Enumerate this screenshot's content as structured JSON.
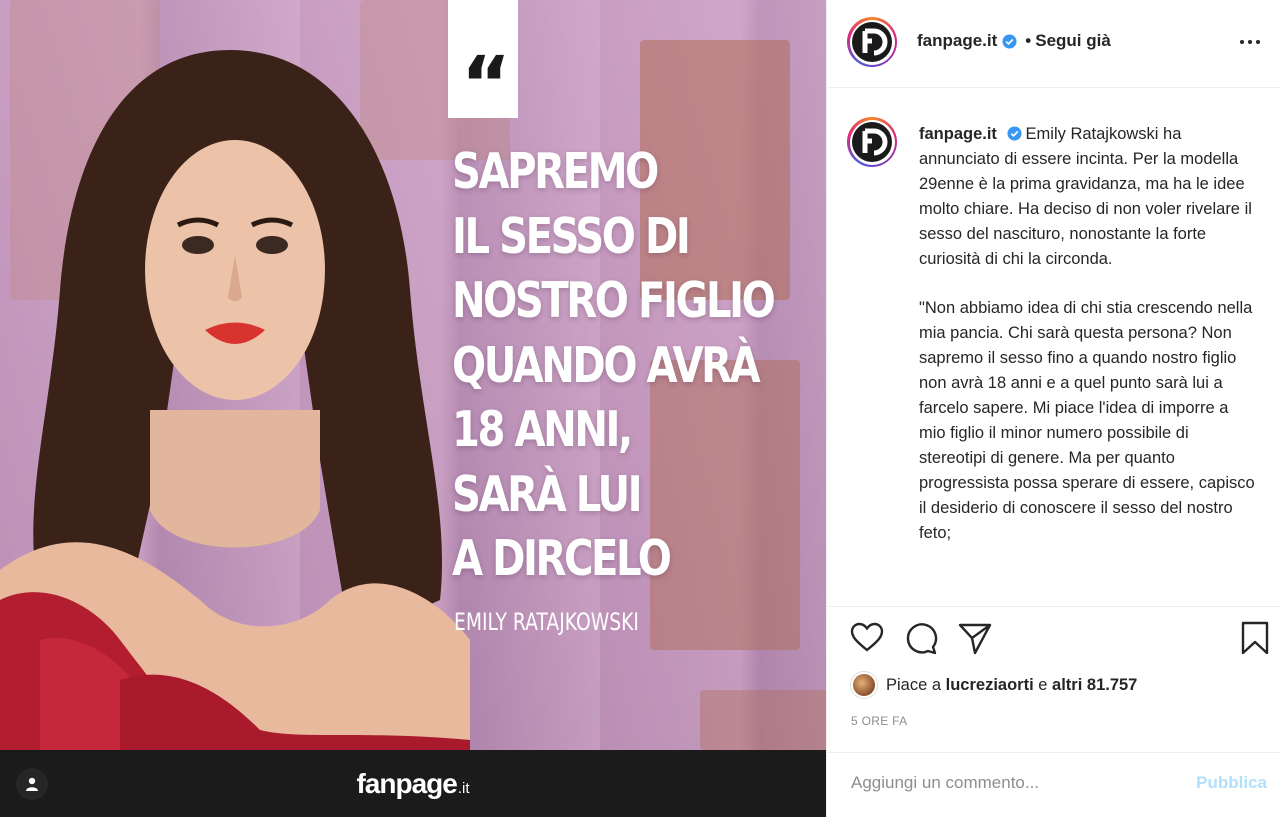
{
  "post": {
    "image": {
      "quote_mark": "“",
      "headline_lines": [
        "SAPREMO",
        "IL SESSO DI",
        "NOSTRO FIGLIO",
        "QUANDO AVRÀ",
        "18 ANNI,",
        "SARÀ LUI",
        "A DIRCELO"
      ],
      "attribution": "EMILY RATAJKOWSKI",
      "brand_main": "fanpage",
      "brand_suffix": ".it"
    },
    "header": {
      "username": "fanpage.it",
      "separator": "•",
      "follow_label": "Segui già"
    },
    "caption": {
      "username": "fanpage.it",
      "paragraph1": "Emily Ratajkowski ha annunciato di essere incinta. Per la modella 29enne è la prima gravidanza, ma ha le idee molto chiare. Ha deciso di non voler rivelare il sesso del nascituro, nonostante la forte curiosità di chi la circonda.",
      "paragraph2": "\"Non abbiamo idea di chi stia crescendo nella mia pancia. Chi sarà questa persona? Non sapremo il sesso fino a quando nostro figlio non avrà 18 anni e a quel punto sarà lui a farcelo sapere. Mi piace l'idea di imporre a mio figlio il minor numero possibile di stereotipi di genere. Ma per quanto progressista possa sperare di essere, capisco il desiderio di conoscere il sesso del nostro feto;"
    },
    "likes": {
      "prefix": "Piace a",
      "user": "lucreziaorti",
      "conjunction": "e",
      "others": "altri 81.757"
    },
    "time_ago": "5 ORE FA",
    "comment": {
      "placeholder": "Aggiungi un commento...",
      "publish_label": "Pubblica"
    }
  },
  "colors": {
    "verified": "#3897f0",
    "publish_disabled": "#b2dffc",
    "muted": "#8e8e8e"
  },
  "icons": [
    "heart-icon",
    "comment-icon",
    "share-icon",
    "bookmark-icon",
    "more-options-icon",
    "verified-badge-icon",
    "user-tag-icon"
  ]
}
